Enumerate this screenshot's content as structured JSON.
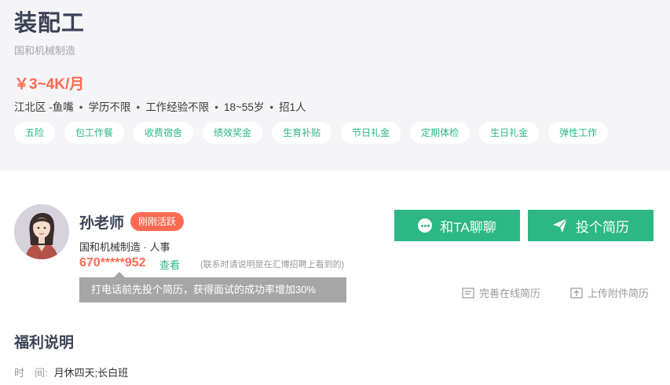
{
  "job": {
    "title": "装配工",
    "company": "国和机械制造",
    "salary": "￥3~4K/月",
    "requirements": [
      "江北区 -鱼嘴",
      "学历不限",
      "工作经验不限",
      "18~55岁",
      "招1人"
    ],
    "tags": [
      "五险",
      "包工作餐",
      "收费宿舍",
      "绩效奖金",
      "生育补贴",
      "节日礼金",
      "定期体检",
      "生日礼金",
      "弹性工作"
    ]
  },
  "contact": {
    "name": "孙老师",
    "active_badge": "刚刚活跃",
    "company_role": "国和机械制造 · 人事",
    "phone_masked": "670*****952",
    "view_label": "查看",
    "phone_note": "(联系时请说明是在汇博招聘上看到的)",
    "tooltip": "打电话前先投个简历，获得面试的成功率增加30%",
    "chat_button": "和TA聊聊",
    "resume_button": "投个简历",
    "complete_resume": "完善在线简历",
    "upload_resume": "上传附件简历"
  },
  "benefits": {
    "title": "福利说明",
    "time_label": "时　间:",
    "time_value": "月休四天;长白班"
  },
  "colors": {
    "accent_green": "#2cb784",
    "salary_orange": "#fc6a52",
    "title_dark": "#3b4256"
  }
}
